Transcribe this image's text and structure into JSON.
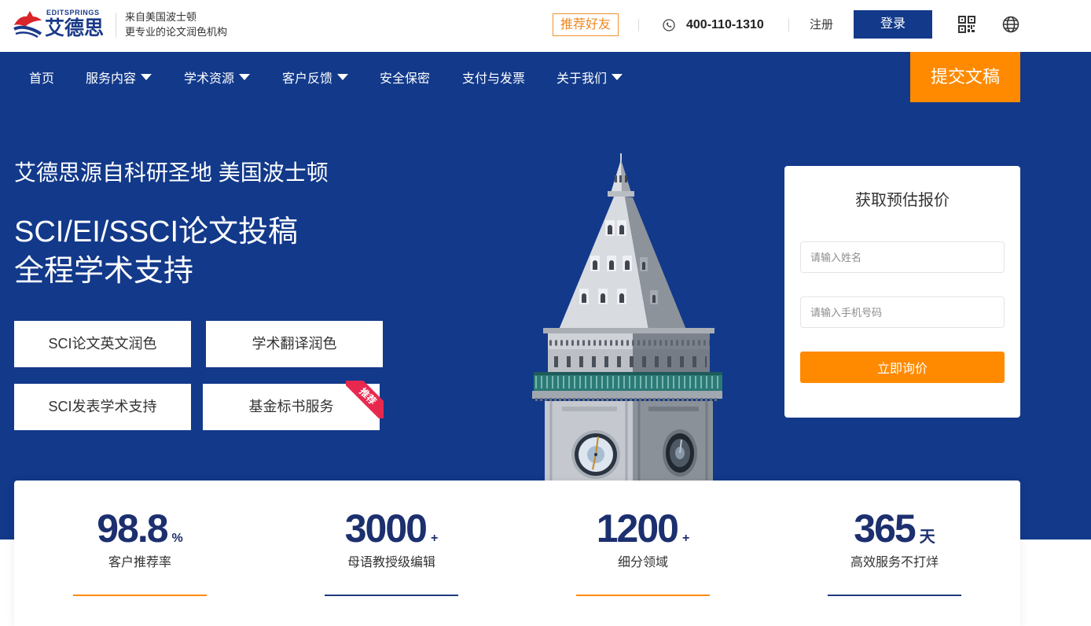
{
  "colors": {
    "brand_blue": "#12398a",
    "accent_orange": "#ff8a00",
    "ribbon_red": "#e8294f",
    "stat_navy": "#1c2f6e"
  },
  "header": {
    "logo": {
      "brand_en": "EDITSPRINGS",
      "brand_cn": "艾德思"
    },
    "tagline": [
      "来自美国波士顿",
      "更专业的论文润色机构"
    ],
    "refer_label": "推荐好友",
    "phone": "400-110-1310",
    "register_label": "注册",
    "login_label": "登录",
    "icons": {
      "phone": "phone-icon",
      "qr_code": "qr-code-icon",
      "language": "globe-icon"
    }
  },
  "nav": {
    "dropdown_icon": "caret-down-icon",
    "items": [
      {
        "label": "首页",
        "dropdown": false
      },
      {
        "label": "服务内容",
        "dropdown": true
      },
      {
        "label": "学术资源",
        "dropdown": true
      },
      {
        "label": "客户反馈",
        "dropdown": true
      },
      {
        "label": "安全保密",
        "dropdown": false
      },
      {
        "label": "支付与发票",
        "dropdown": false
      },
      {
        "label": "关于我们",
        "dropdown": true
      }
    ],
    "submit_label": "提交文稿"
  },
  "hero": {
    "subtitle": "艾德思源自科研圣地 美国波士顿",
    "title": [
      "SCI/EI/SSCI论文投稿",
      "全程学术支持"
    ],
    "services": [
      {
        "label": "SCI论文英文润色"
      },
      {
        "label": "学术翻译润色"
      },
      {
        "label": "SCI发表学术支持"
      },
      {
        "label": "基金标书服务",
        "badge": "推荐"
      }
    ]
  },
  "quote_form": {
    "title": "获取预估报价",
    "name_placeholder": "请输入姓名",
    "phone_placeholder": "请输入手机号码",
    "submit_label": "立即询价"
  },
  "stats": [
    {
      "value": "98.8",
      "unit": "%",
      "label": "客户推荐率",
      "accent": "#ff8a00"
    },
    {
      "value": "3000",
      "unit": "+",
      "label": "母语教授级编辑",
      "accent": "#1f3a7e"
    },
    {
      "value": "1200",
      "unit": "+",
      "label": "细分领域",
      "accent": "#ff8a00"
    },
    {
      "value": "365",
      "unit": "天",
      "label": "高效服务不打烊",
      "accent": "#1f3a7e"
    }
  ]
}
